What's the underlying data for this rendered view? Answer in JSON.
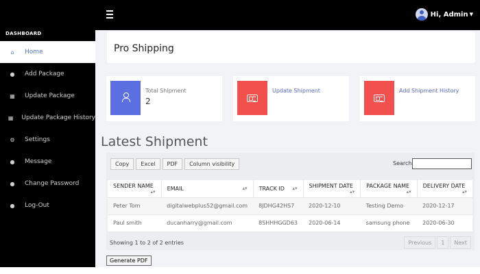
{
  "topbar": {
    "user_label": "Hi, Admin"
  },
  "sidebar": {
    "heading": "DASHBOARD",
    "items": [
      {
        "label": "Home",
        "icon": "home-icon",
        "active": true
      },
      {
        "label": "Add Package",
        "icon": "user-icon"
      },
      {
        "label": "Update Package",
        "icon": "grid-icon"
      },
      {
        "label": "Update Package History",
        "icon": "grid-icon"
      },
      {
        "label": "Settings",
        "icon": "gear-icon"
      },
      {
        "label": "Message",
        "icon": "chat-icon"
      },
      {
        "label": "Change Password",
        "icon": "chat-icon"
      },
      {
        "label": "Log-Out",
        "icon": "user-icon"
      }
    ]
  },
  "page": {
    "title": "Pro Shipping",
    "section_title": "Latest Shipment"
  },
  "cards": {
    "total_label": "Total Shipment",
    "total_value": "2",
    "update_label": "Update Shipment",
    "history_label": "Add Shipment History"
  },
  "colors": {
    "accent_blue": "#5b6fe0",
    "accent_red": "#f2504d",
    "link_blue": "#4a76d0"
  },
  "table": {
    "buttons": [
      "Copy",
      "Excel",
      "PDF",
      "Column visibility"
    ],
    "search_label": "Search:",
    "headers": [
      "SENDER NAME",
      "EMAIL",
      "TRACK ID",
      "SHIPMENT DATE",
      "PACKAGE NAME",
      "DELIVERY DATE"
    ],
    "rows": [
      [
        "Peter Tom",
        "digitalwebplus52@gmail.com",
        "8JDHG42HS7",
        "2020-12-10",
        "Testing Demo",
        "2020-12-17"
      ],
      [
        "Paul smith",
        "ducanharry@gmail.com",
        "8SHHHGGD63",
        "2020-06-14",
        "samsung phone",
        "2020-06-30"
      ]
    ],
    "info": "Showing 1 to 2 of 2 entries",
    "pager": {
      "previous": "Previous",
      "page": "1",
      "next": "Next"
    }
  },
  "footer_button": "Generate PDF"
}
